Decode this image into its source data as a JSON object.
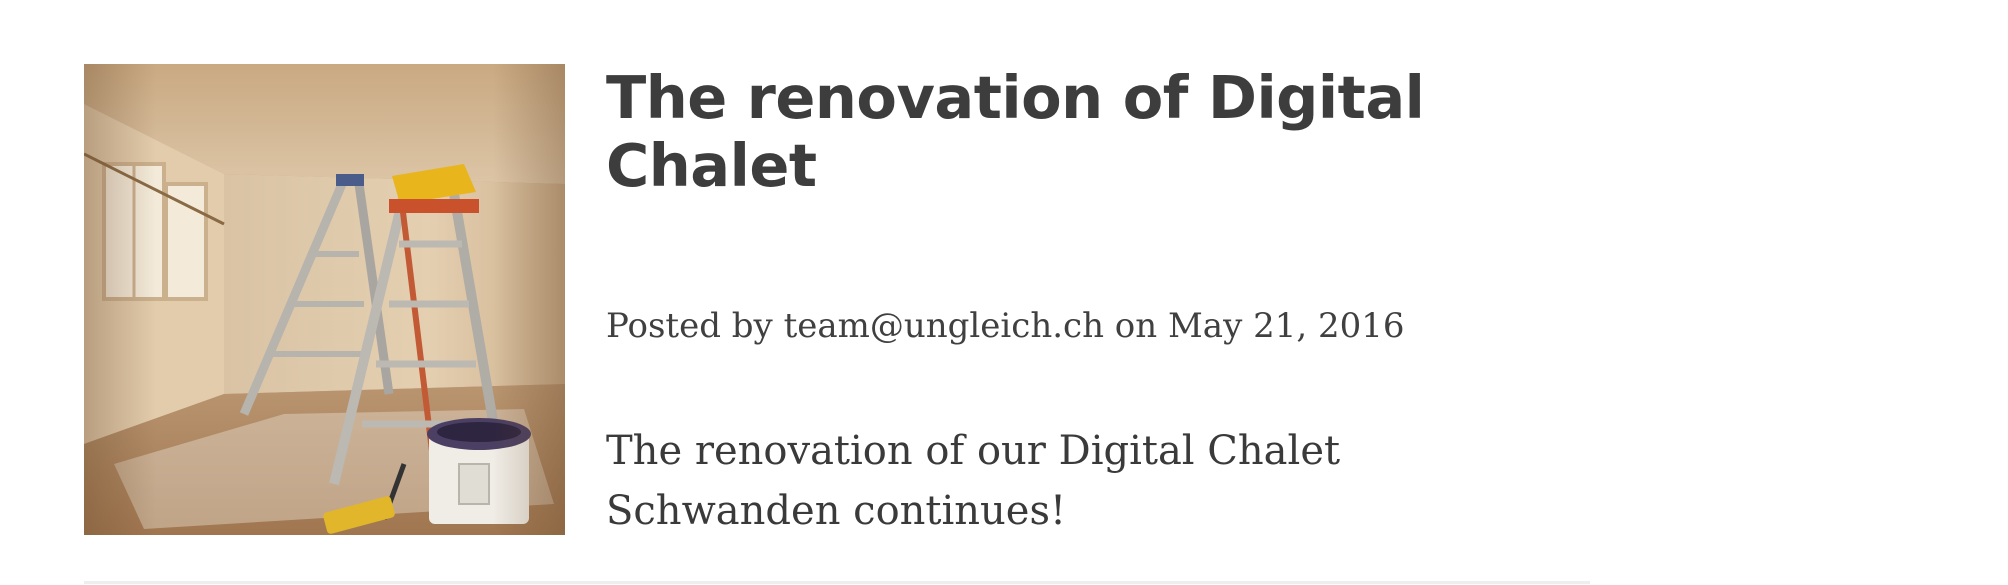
{
  "post": {
    "title": "The renovation of Digital Chalet",
    "meta": {
      "prefix": "Posted by",
      "author": "team@ungleich.ch",
      "on": "on",
      "date": "May 21, 2016"
    },
    "excerpt": "The renovation of our Digital Chalet Schwanden continues!",
    "image_subject": "room-renovation-ladders-paint-bucket"
  },
  "colors": {
    "title": "#3d3d3d",
    "text": "#3a3a3a",
    "divider": "#eeeeee"
  }
}
